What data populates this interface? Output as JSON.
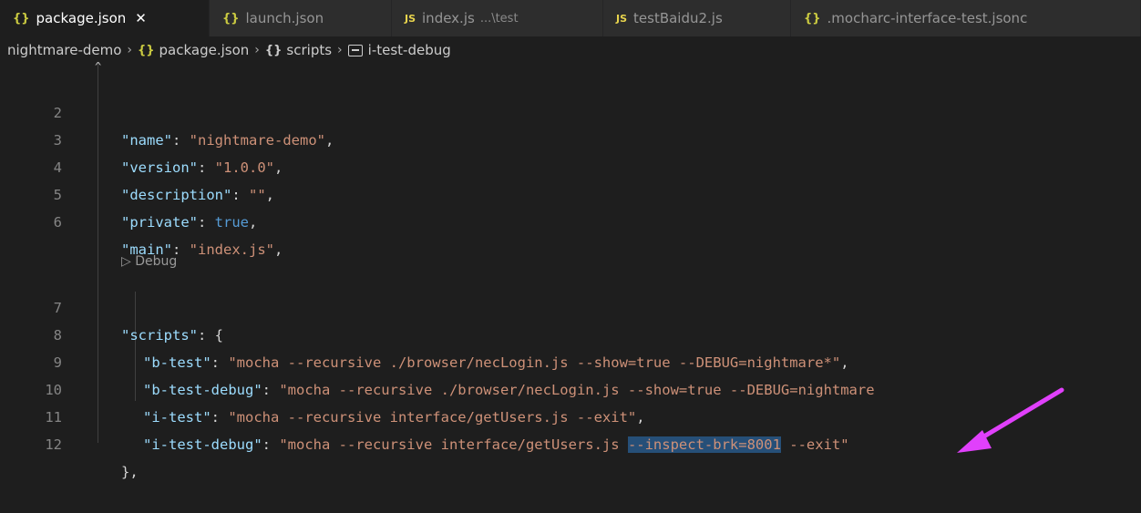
{
  "tabs": [
    {
      "icon": "{}",
      "label": "package.json",
      "hint": "",
      "close": "✕",
      "active": true
    },
    {
      "icon": "{}",
      "label": "launch.json",
      "hint": "",
      "active": false
    },
    {
      "icon": "JS",
      "label": "index.js",
      "hint": "...\\test",
      "active": false
    },
    {
      "icon": "JS",
      "label": "testBaidu2.js",
      "hint": "",
      "active": false
    },
    {
      "icon": "{}",
      "label": ".mocharc-interface-test.jsonc",
      "hint": "",
      "active": false
    }
  ],
  "breadcrumb": {
    "root": "nightmare-demo",
    "file_icon": "{}",
    "file": "package.json",
    "obj_icon": "{}",
    "obj": "scripts",
    "leaf": "i-test-debug",
    "separator": "›"
  },
  "codelens": "▷ Debug",
  "lines": [
    {
      "n": "2",
      "key": "\"name\"",
      "colon": ": ",
      "val": "\"nightmare-demo\"",
      "end": ","
    },
    {
      "n": "3",
      "key": "\"version\"",
      "colon": ": ",
      "val": "\"1.0.0\"",
      "end": ","
    },
    {
      "n": "4",
      "key": "\"description\"",
      "colon": ": ",
      "val": "\"\"",
      "end": ","
    },
    {
      "n": "5",
      "key": "\"private\"",
      "colon": ": ",
      "val": "true",
      "end": ","
    },
    {
      "n": "6",
      "key": "\"main\"",
      "colon": ": ",
      "val": "\"index.js\"",
      "end": ","
    },
    {
      "n": "7",
      "key": "\"scripts\"",
      "colon": ": ",
      "val": "{",
      "end": ""
    },
    {
      "n": "8",
      "key": "\"b-test\"",
      "colon": ": ",
      "val": "\"mocha --recursive ./browser/necLogin.js --show=true --DEBUG=nightmare*\"",
      "end": ","
    },
    {
      "n": "9",
      "key": "\"b-test-debug\"",
      "colon": ": ",
      "val": "\"mocha --recursive ./browser/necLogin.js --show=true --DEBUG=nightmare",
      "end": ""
    },
    {
      "n": "10",
      "key": "\"i-test\"",
      "colon": ": ",
      "val": "\"mocha --recursive interface/getUsers.js --exit\"",
      "end": ","
    },
    {
      "n": "11",
      "key": "\"i-test-debug\"",
      "colon": ": ",
      "val_a": "\"mocha --recursive interface/getUsers.js ",
      "val_sel": "--inspect-brk=8001",
      "val_b": " --exit\""
    },
    {
      "n": "12",
      "key": "",
      "colon": "",
      "val": "},",
      "end": ""
    }
  ],
  "colors": {
    "key": "#9cdcfe",
    "string": "#ce9178",
    "keyword": "#569cd6",
    "selection": "#264f78",
    "annotation_arrow": "#e040fb"
  },
  "annotation": {
    "arrow_icon": "pink-arrow-icon"
  }
}
